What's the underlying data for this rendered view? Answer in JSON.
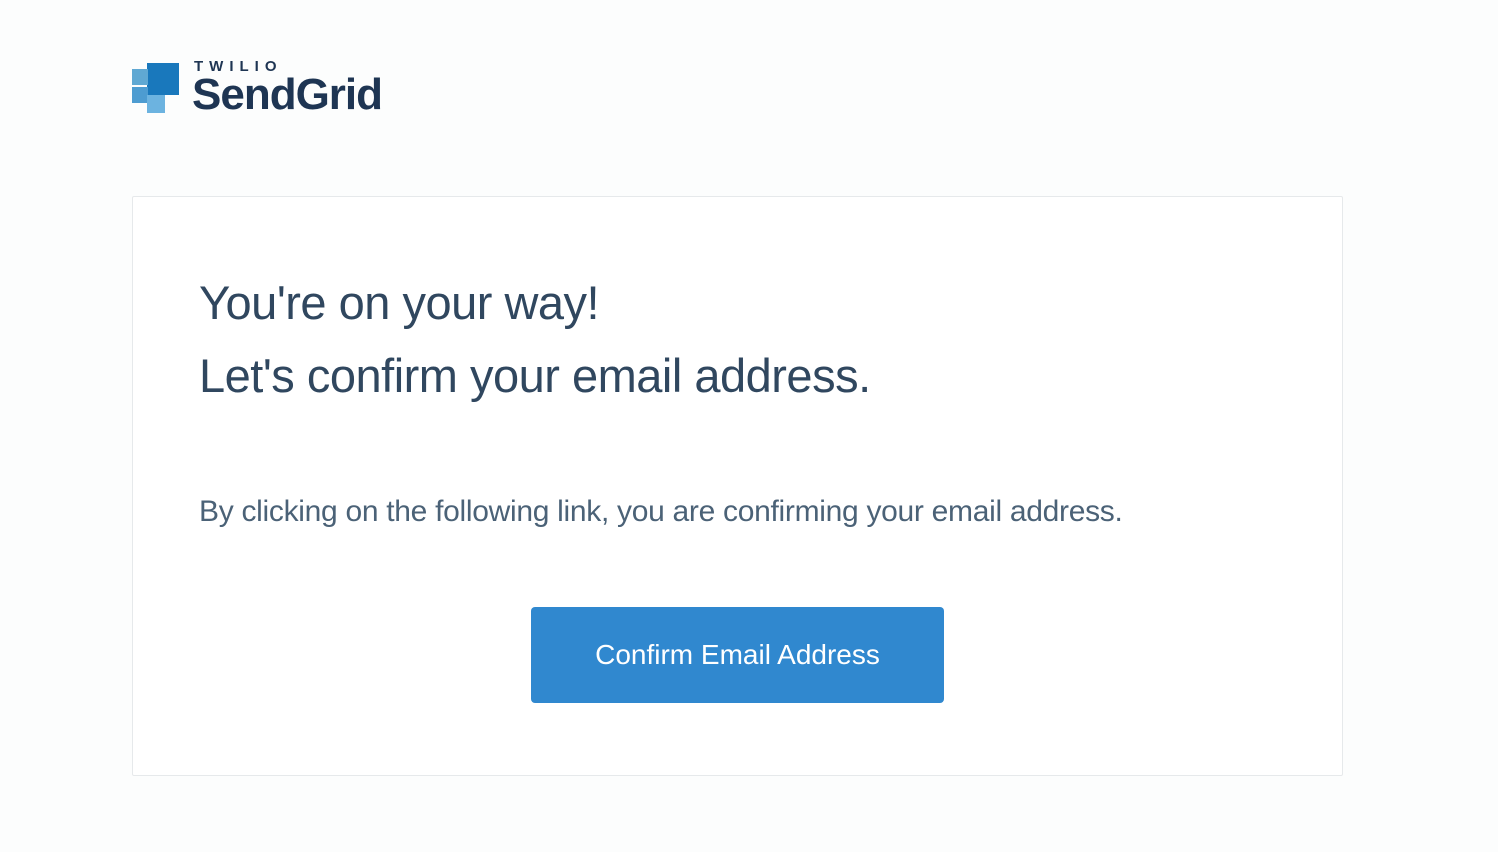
{
  "logo": {
    "overline": "TWILIO",
    "brand": "SendGrid"
  },
  "content": {
    "heading_line1": "You're on your way!",
    "heading_line2": "Let's confirm your email address.",
    "body": "By clicking on the following link, you are confirming your email address.",
    "cta_label": "Confirm Email Address"
  }
}
